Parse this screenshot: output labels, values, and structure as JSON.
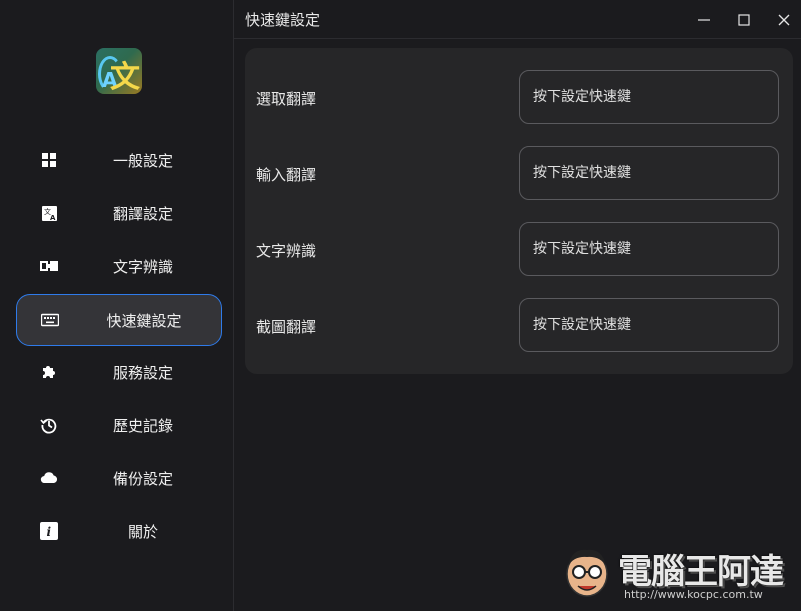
{
  "window": {
    "title": "快速鍵設定"
  },
  "sidebar": {
    "items": [
      {
        "label": "一般設定",
        "icon": "grid-icon"
      },
      {
        "label": "翻譯設定",
        "icon": "translate-icon"
      },
      {
        "label": "文字辨識",
        "icon": "ocr-icon"
      },
      {
        "label": "快速鍵設定",
        "icon": "keyboard-icon",
        "active": true
      },
      {
        "label": "服務設定",
        "icon": "puzzle-icon"
      },
      {
        "label": "歷史記錄",
        "icon": "history-icon"
      },
      {
        "label": "備份設定",
        "icon": "cloud-icon"
      },
      {
        "label": "關於",
        "icon": "info-icon"
      }
    ]
  },
  "hotkeys": {
    "rows": [
      {
        "label": "選取翻譯",
        "placeholder": "按下設定快速鍵"
      },
      {
        "label": "輸入翻譯",
        "placeholder": "按下設定快速鍵"
      },
      {
        "label": "文字辨識",
        "placeholder": "按下設定快速鍵"
      },
      {
        "label": "截圖翻譯",
        "placeholder": "按下設定快速鍵"
      }
    ]
  },
  "watermark": {
    "text": "電腦王阿達",
    "url": "http://www.kocpc.com.tw"
  },
  "colors": {
    "accent": "#2f7bea",
    "background": "#1b1b1e",
    "panel": "#262628"
  }
}
